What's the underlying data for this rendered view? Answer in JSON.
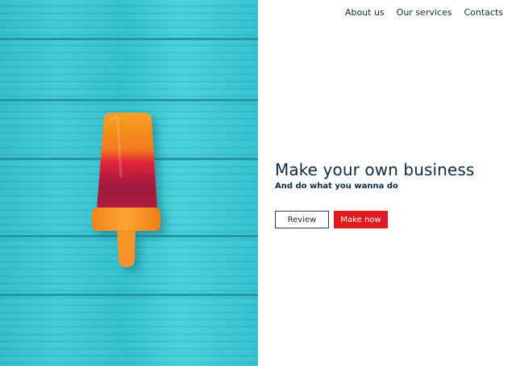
{
  "nav": {
    "items": [
      "About us",
      "Our services",
      "Contacts"
    ]
  },
  "hero": {
    "image_description_icon": "popsicle-on-teal-wood-image"
  },
  "content": {
    "headline": "Make your own business",
    "subline": "And do what you wanna do"
  },
  "buttons": {
    "review_label": "Review",
    "make_label": "Make now"
  },
  "colors": {
    "accent_red": "#e01b1f",
    "teal": "#31c2cf",
    "text_dark": "#0d2a40"
  }
}
